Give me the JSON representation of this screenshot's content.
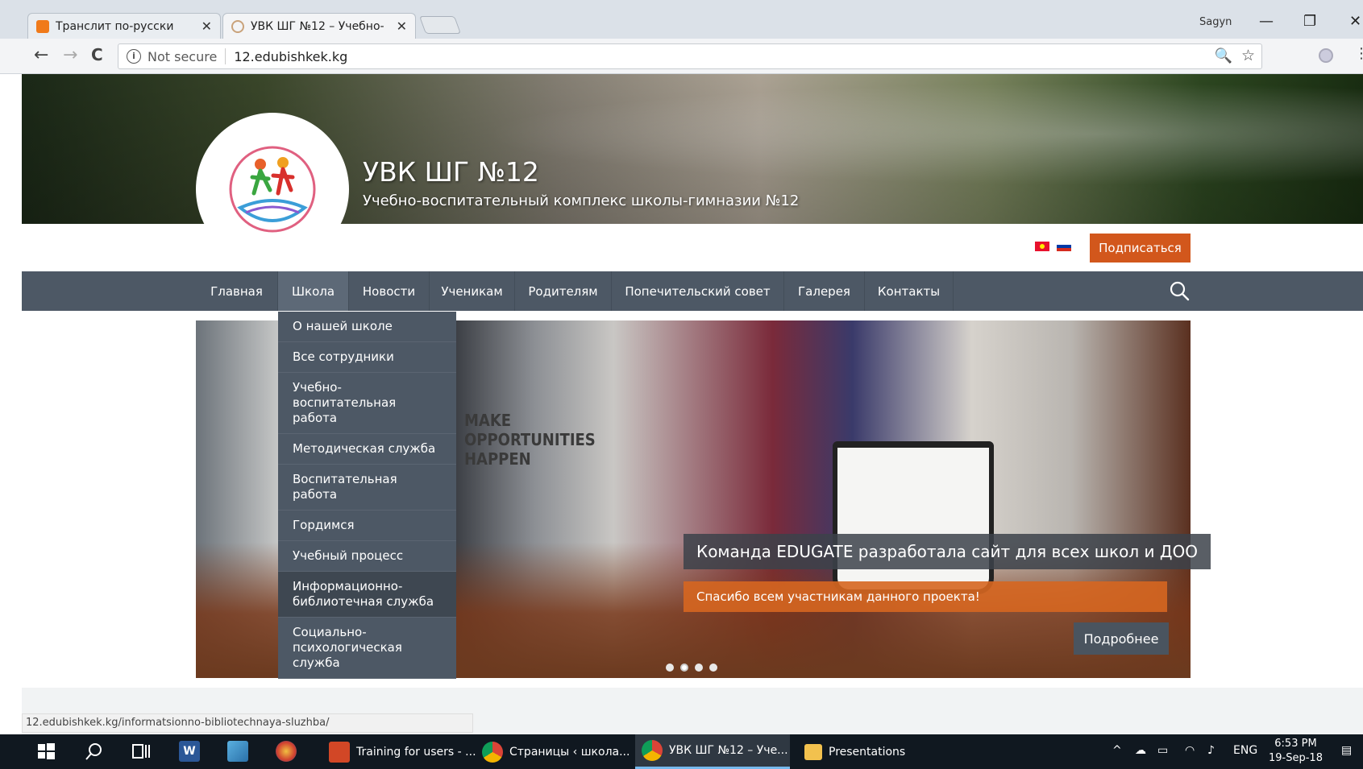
{
  "browser": {
    "tabs": [
      {
        "title": "Транслит по-русски",
        "close": "✕"
      },
      {
        "title": "УВК ШГ №12 – Учебно-",
        "close": "✕"
      }
    ],
    "user": "Sagyn",
    "window_controls": {
      "minimize": "—",
      "restore": "❐",
      "close": "✕"
    },
    "address": {
      "security": "Not secure",
      "url": "12.edubishkek.kg"
    },
    "icons": {
      "back": "←",
      "forward": "→",
      "reload": "C",
      "zoom": "🔍",
      "star": "☆",
      "menu": "⋮",
      "info": "i"
    }
  },
  "site": {
    "title": "УВК ШГ №12",
    "subtitle": "Учебно-воспитательный комплекс школы-гимназии №12",
    "subscribe": "Подписаться",
    "nav": [
      "Главная",
      "Школа",
      "Новости",
      "Ученикам",
      "Родителям",
      "Попечительский совет",
      "Галерея",
      "Контакты"
    ],
    "dropdown": [
      "О нашей школе",
      "Все сотрудники",
      "Учебно-воспитательная работа",
      "Методическая служба",
      "Воспитательная работа",
      "Гордимся",
      "Учебный процесс",
      "Информационно-библиотечная служба",
      "Социально-психологическая служба"
    ],
    "slide": {
      "poster_text": "MAKE OPPORTUNITIES HAPPEN",
      "caption_title": "Команда EDUGATE разработала сайт для всех школ и ДОО",
      "caption_sub": "Спасибо всем участникам данного проекта!",
      "more": "Подробнее",
      "dot_count": 4,
      "active_dot": 2
    },
    "status_url": "12.edubishkek.kg/informatsionno-bibliotechnaya-sluzhba/"
  },
  "taskbar": {
    "apps": [
      "Training for users - ...",
      "Страницы ‹ школа...",
      "УВК ШГ №12 – Уче...",
      "Presentations"
    ],
    "lang": "ENG",
    "time": "6:53 PM",
    "date": "19-Sep-18"
  },
  "colors": {
    "accent": "#d2571c",
    "nav": "#4d5865"
  }
}
